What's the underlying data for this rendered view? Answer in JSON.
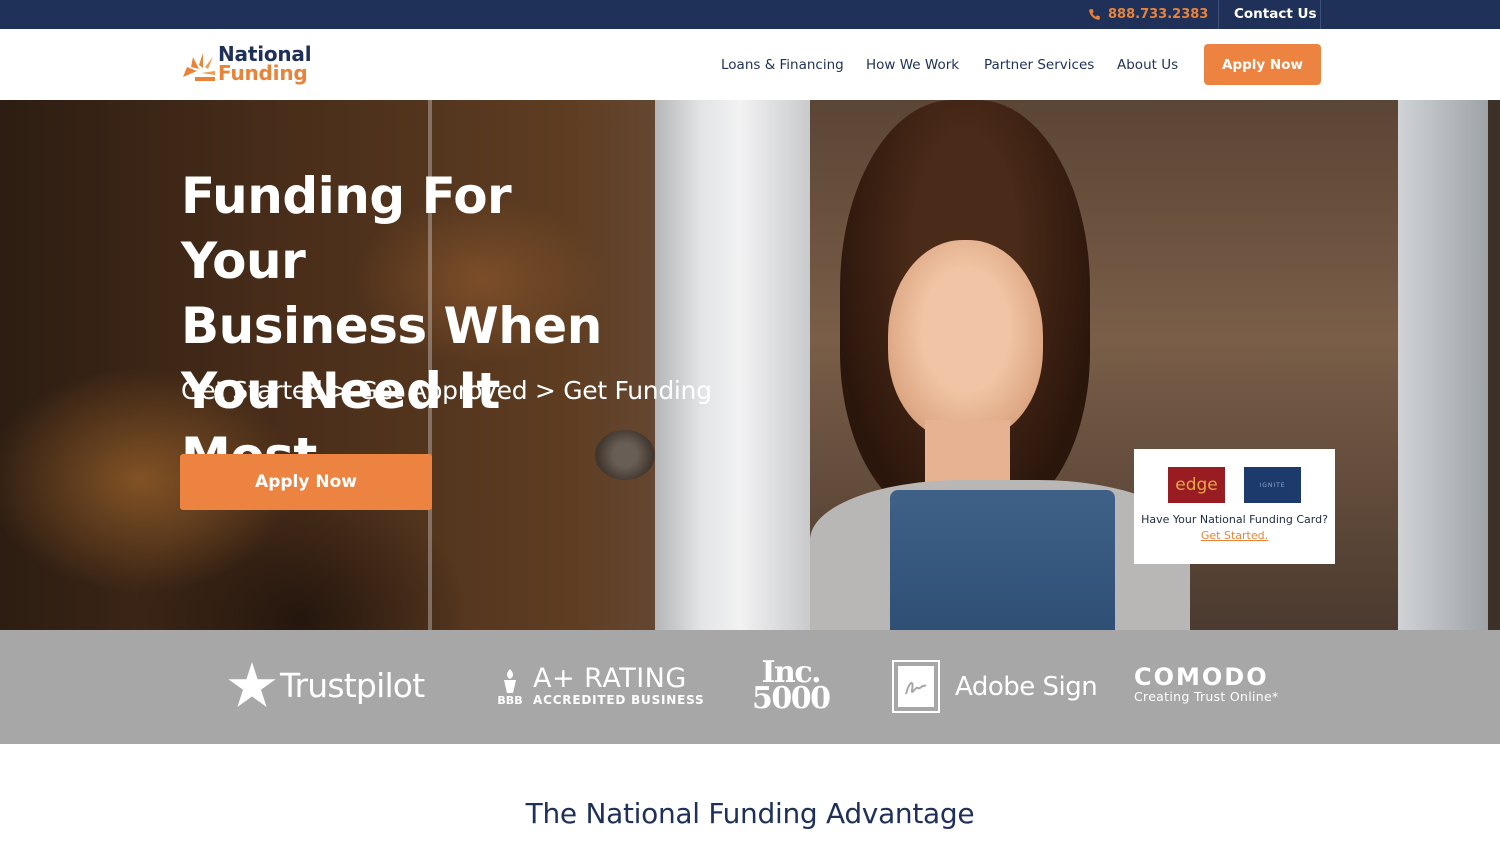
{
  "topbar": {
    "phone": "888.733.2383",
    "contact_label": "Contact Us"
  },
  "header": {
    "logo_line1": "National",
    "logo_line2": "Funding",
    "nav": [
      {
        "label": "Loans & Financing"
      },
      {
        "label": "How We Work"
      },
      {
        "label": "Partner Services"
      },
      {
        "label": "About Us"
      }
    ],
    "apply_label": "Apply Now"
  },
  "hero": {
    "title_lines": [
      "Funding For Your",
      "Business When",
      "You Need It Most"
    ],
    "steps": "Get Started > Get Approved > Get Funding",
    "cta_label": "Apply Now",
    "card": {
      "edge_label": "edge",
      "ignite_label": "IGNITE",
      "text": "Have Your National Funding Card?",
      "link": "Get Started."
    }
  },
  "trust": {
    "trustpilot": "Trustpilot",
    "bbb_main": "A+ RATING",
    "bbb_mark": "BBB",
    "bbb_sub": "ACCREDITED BUSINESS",
    "inc_line1": "Inc.",
    "inc_line2": "5000",
    "adobe": "Adobe Sign",
    "comodo_main": "COMODO",
    "comodo_sub": "Creating Trust Online*"
  },
  "section": {
    "title": "The National Funding Advantage"
  },
  "colors": {
    "navy": "#1f3158",
    "orange": "#ec8340",
    "trust_bar": "#a7a7a7"
  }
}
